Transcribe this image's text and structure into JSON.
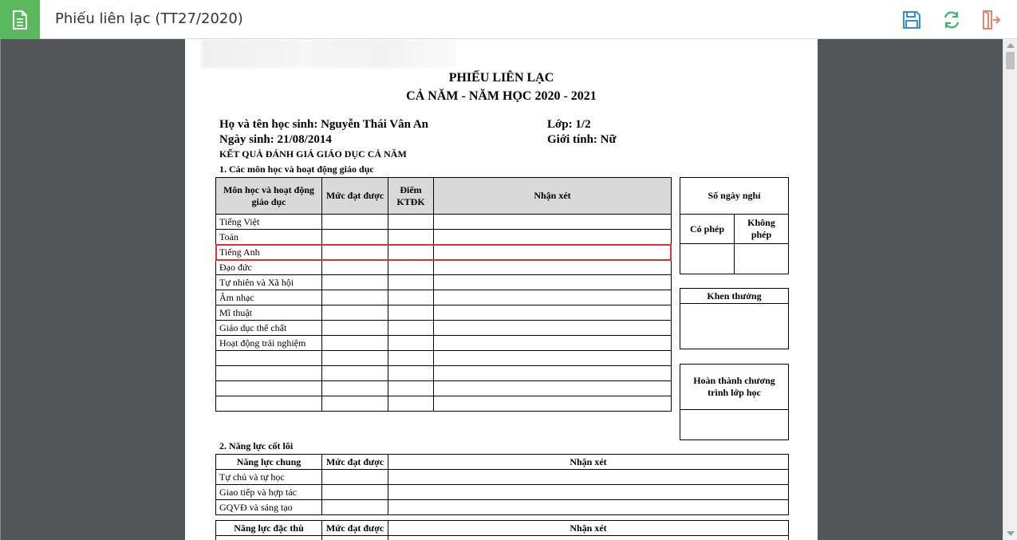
{
  "window": {
    "title": "Phiếu liên lạc (TT27/2020)",
    "icons": {
      "app": "document-icon",
      "save": "save-icon",
      "refresh": "refresh-icon",
      "exit": "exit-icon"
    },
    "colors": {
      "app_icon_bg": "#5cb85c",
      "save": "#2f8fdc",
      "refresh": "#3cb371",
      "exit": "#ef7f6a",
      "viewer_bg": "#525659",
      "highlight": "#e03232"
    }
  },
  "document": {
    "title": "PHIẾU LIÊN LẠC",
    "subtitle": "CẢ NĂM - NĂM HỌC 2020 - 2021",
    "student_name": "Họ và tên học sinh: Nguyễn Thái Vân An",
    "class": "Lớp: 1/2",
    "dob": "Ngày sinh: 21/08/2014",
    "gender": "Giới tính: Nữ",
    "section_title": "KẾT QUẢ ĐÁNH GIÁ GIÁO DỤC CẢ NĂM",
    "subjects_heading": "1. Các môn học và hoạt động giáo dục",
    "subjects_table": {
      "headers": [
        "Môn học và hoạt động giáo dục",
        "Mức đạt được",
        "Điểm KTĐK",
        "Nhận xét"
      ],
      "rows": [
        "Tiếng Việt",
        "Toán",
        "Tiếng Anh",
        "Đạo đức",
        "Tự nhiên và Xã hội",
        "Âm nhạc",
        "Mĩ thuật",
        "Giáo dục thể chất",
        "Hoạt động trải nghiệm",
        "",
        "",
        "",
        ""
      ]
    },
    "absence_table": {
      "title": "Số ngày nghỉ",
      "col1": "Có phép",
      "col2": "Không phép"
    },
    "reward_table": {
      "title": "Khen thưởng"
    },
    "completion_table": {
      "title": "Hoàn thành chương trình lớp học"
    },
    "competency_heading": "2. Năng lực cốt lõi",
    "general_competency": {
      "headers": [
        "Năng lực chung",
        "Mức đạt được",
        "Nhận xét"
      ],
      "rows": [
        "Tự chủ và tự học",
        "Giao tiếp và hợp tác",
        "GQVĐ và sáng tạo"
      ]
    },
    "specific_competency": {
      "headers": [
        "Năng lực đặc thù",
        "Mức đạt được",
        "Nhận xét"
      ]
    }
  }
}
